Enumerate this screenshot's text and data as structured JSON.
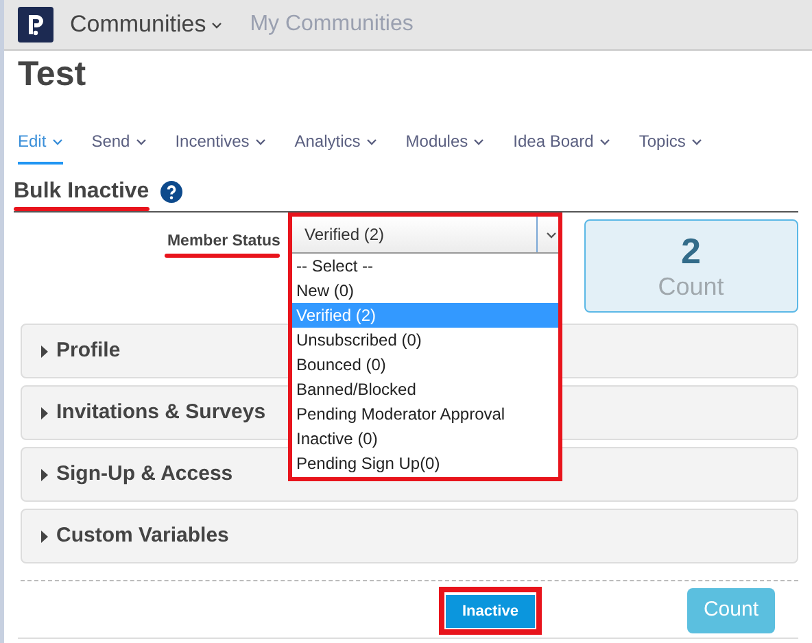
{
  "header": {
    "menu": "Communities",
    "link": "My Communities"
  },
  "title": "Test",
  "nav": [
    {
      "label": "Edit",
      "selected": true
    },
    {
      "label": "Send",
      "selected": false
    },
    {
      "label": "Incentives",
      "selected": false
    },
    {
      "label": "Analytics",
      "selected": false
    },
    {
      "label": "Modules",
      "selected": false
    },
    {
      "label": "Idea Board",
      "selected": false
    },
    {
      "label": "Topics",
      "selected": false
    }
  ],
  "section": {
    "title": "Bulk Inactive",
    "highlighted": true
  },
  "member_status": {
    "label": "Member Status",
    "label_highlighted": true,
    "value": "Verified (2)",
    "expanded": true,
    "highlighted": true,
    "options": [
      {
        "label": "-- Select --",
        "selected": false
      },
      {
        "label": "New (0)",
        "selected": false
      },
      {
        "label": "Verified (2)",
        "selected": true
      },
      {
        "label": "Unsubscribed (0)",
        "selected": false
      },
      {
        "label": "Bounced (0)",
        "selected": false
      },
      {
        "label": "Banned/Blocked",
        "selected": false
      },
      {
        "label": "Pending Moderator Approval",
        "selected": false
      },
      {
        "label": "Inactive (0)",
        "selected": false
      },
      {
        "label": "Pending Sign Up(0)",
        "selected": false
      }
    ]
  },
  "count_card": {
    "value": "2",
    "label": "Count"
  },
  "accordions": [
    {
      "title": "Profile",
      "expanded": false
    },
    {
      "title": "Invitations & Surveys",
      "expanded": false
    },
    {
      "title": "Sign-Up & Access",
      "expanded": false
    },
    {
      "title": "Custom Variables",
      "expanded": false
    }
  ],
  "buttons": [
    {
      "label": "Inactive",
      "kind": "primary",
      "highlighted": true
    },
    {
      "label": "Count",
      "kind": "secondary"
    }
  ]
}
